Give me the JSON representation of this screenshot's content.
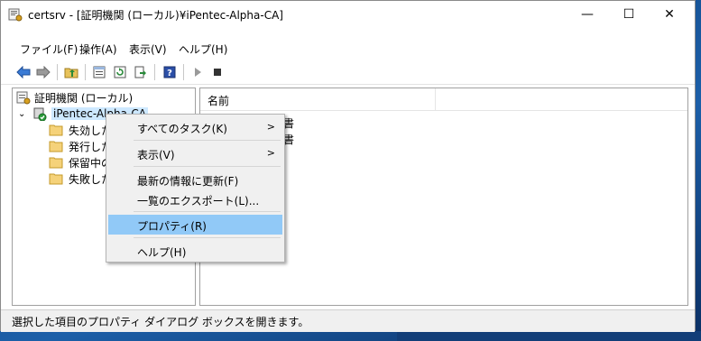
{
  "window": {
    "title": "certsrv - [証明機関 (ローカル)¥iPentec-Alpha-CA]",
    "controls": {
      "minimize": "—",
      "maximize": "☐",
      "close": "✕"
    }
  },
  "menubar": [
    {
      "label": "ファイル(F)"
    },
    {
      "label": "操作(A)"
    },
    {
      "label": "表示(V)"
    },
    {
      "label": "ヘルプ(H)"
    }
  ],
  "tree": {
    "root": "証明機関 (ローカル)",
    "ca": "iPentec-Alpha-CA",
    "folders": [
      "失効した",
      "発行した",
      "保留中の",
      "失敗した"
    ]
  },
  "list": {
    "column_name": "名前",
    "items_visible_partial": [
      "書",
      "書"
    ]
  },
  "context_menu": {
    "items": [
      {
        "label": "すべてのタスク(K)",
        "submenu": true
      },
      {
        "label": "表示(V)",
        "submenu": true
      },
      {
        "label": "最新の情報に更新(F)",
        "submenu": false
      },
      {
        "label": "一覧のエクスポート(L)...",
        "submenu": false
      },
      {
        "label": "プロパティ(R)",
        "submenu": false,
        "selected": true
      },
      {
        "label": "ヘルプ(H)",
        "submenu": false
      }
    ],
    "submenu_arrow": ">"
  },
  "statusbar": {
    "text": "選択した項目のプロパティ ダイアログ ボックスを開きます。"
  },
  "colors": {
    "selection": "#91c9f7",
    "menu_bg": "#f0f0f0",
    "desktop": "#1b4f8c"
  }
}
